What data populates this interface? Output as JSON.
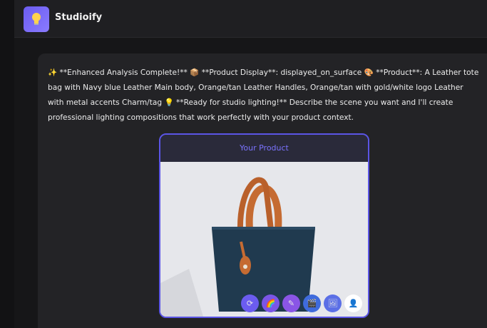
{
  "app": {
    "title": "Studioify",
    "logo_icon": "lightbulb-icon"
  },
  "message": {
    "text": "✨ **Enhanced Analysis Complete!** 📦 **Product Display**: displayed_on_surface 🎨 **Product**: A Leather tote bag with Navy blue Leather Main body, Orange/tan Leather Handles, Orange/tan with gold/white logo Leather with metal accents Charm/tag 💡 **Ready for studio lighting!** Describe the scene you want and I'll create professional lighting compositions that work perfectly with your product context."
  },
  "product_card": {
    "title": "Your Product",
    "image_subject": "navy leather tote bag with tan handles",
    "tools": [
      {
        "icon": "refresh-icon",
        "color": "#6b5cf0"
      },
      {
        "icon": "rainbow-icon",
        "color": "#7b55e6"
      },
      {
        "icon": "wand-icon",
        "color": "#8a55e6"
      },
      {
        "icon": "film-icon",
        "color": "#3f6bdc"
      },
      {
        "icon": "gallery-icon",
        "color": "#5b6fe6"
      },
      {
        "icon": "person-icon",
        "color": "#ffffff"
      }
    ]
  },
  "colors": {
    "accent": "#5b55e6",
    "background": "#1b1b1e"
  }
}
